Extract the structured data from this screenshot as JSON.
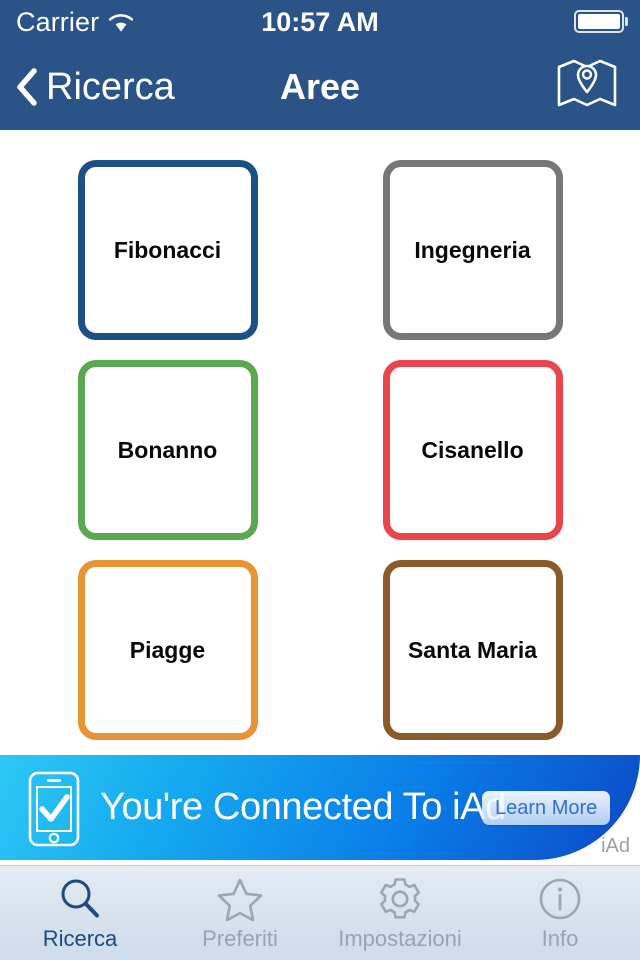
{
  "status_bar": {
    "carrier": "Carrier",
    "wifi_icon": "wifi-icon",
    "time": "10:57 AM",
    "battery_icon": "battery-full-icon"
  },
  "nav_bar": {
    "back_icon": "chevron-left-icon",
    "back_label": "Ricerca",
    "title": "Aree",
    "map_icon": "map-pin-icon",
    "background_color": "#2a5387"
  },
  "areas": [
    {
      "name": "Fibonacci",
      "color": "#1d5185"
    },
    {
      "name": "Ingegneria",
      "color": "#777777"
    },
    {
      "name": "Bonanno",
      "color": "#5aa84f"
    },
    {
      "name": "Cisanello",
      "color": "#e8464c"
    },
    {
      "name": "Piagge",
      "color": "#e89334"
    },
    {
      "name": "Santa Maria",
      "color": "#8b5a2b"
    }
  ],
  "ad_banner": {
    "phone_icon": "phone-check-icon",
    "headline": "You're Connected To iAd",
    "learn_more_label": "Learn More",
    "network_label": "iAd"
  },
  "tab_bar": {
    "tabs": [
      {
        "label": "Ricerca",
        "icon": "search-icon",
        "active": true
      },
      {
        "label": "Preferiti",
        "icon": "star-icon",
        "active": false
      },
      {
        "label": "Impostazioni",
        "icon": "gear-icon",
        "active": false
      },
      {
        "label": "Info",
        "icon": "info-icon",
        "active": false
      }
    ],
    "active_color": "#1d4b7e",
    "inactive_color": "#97a3b0"
  }
}
